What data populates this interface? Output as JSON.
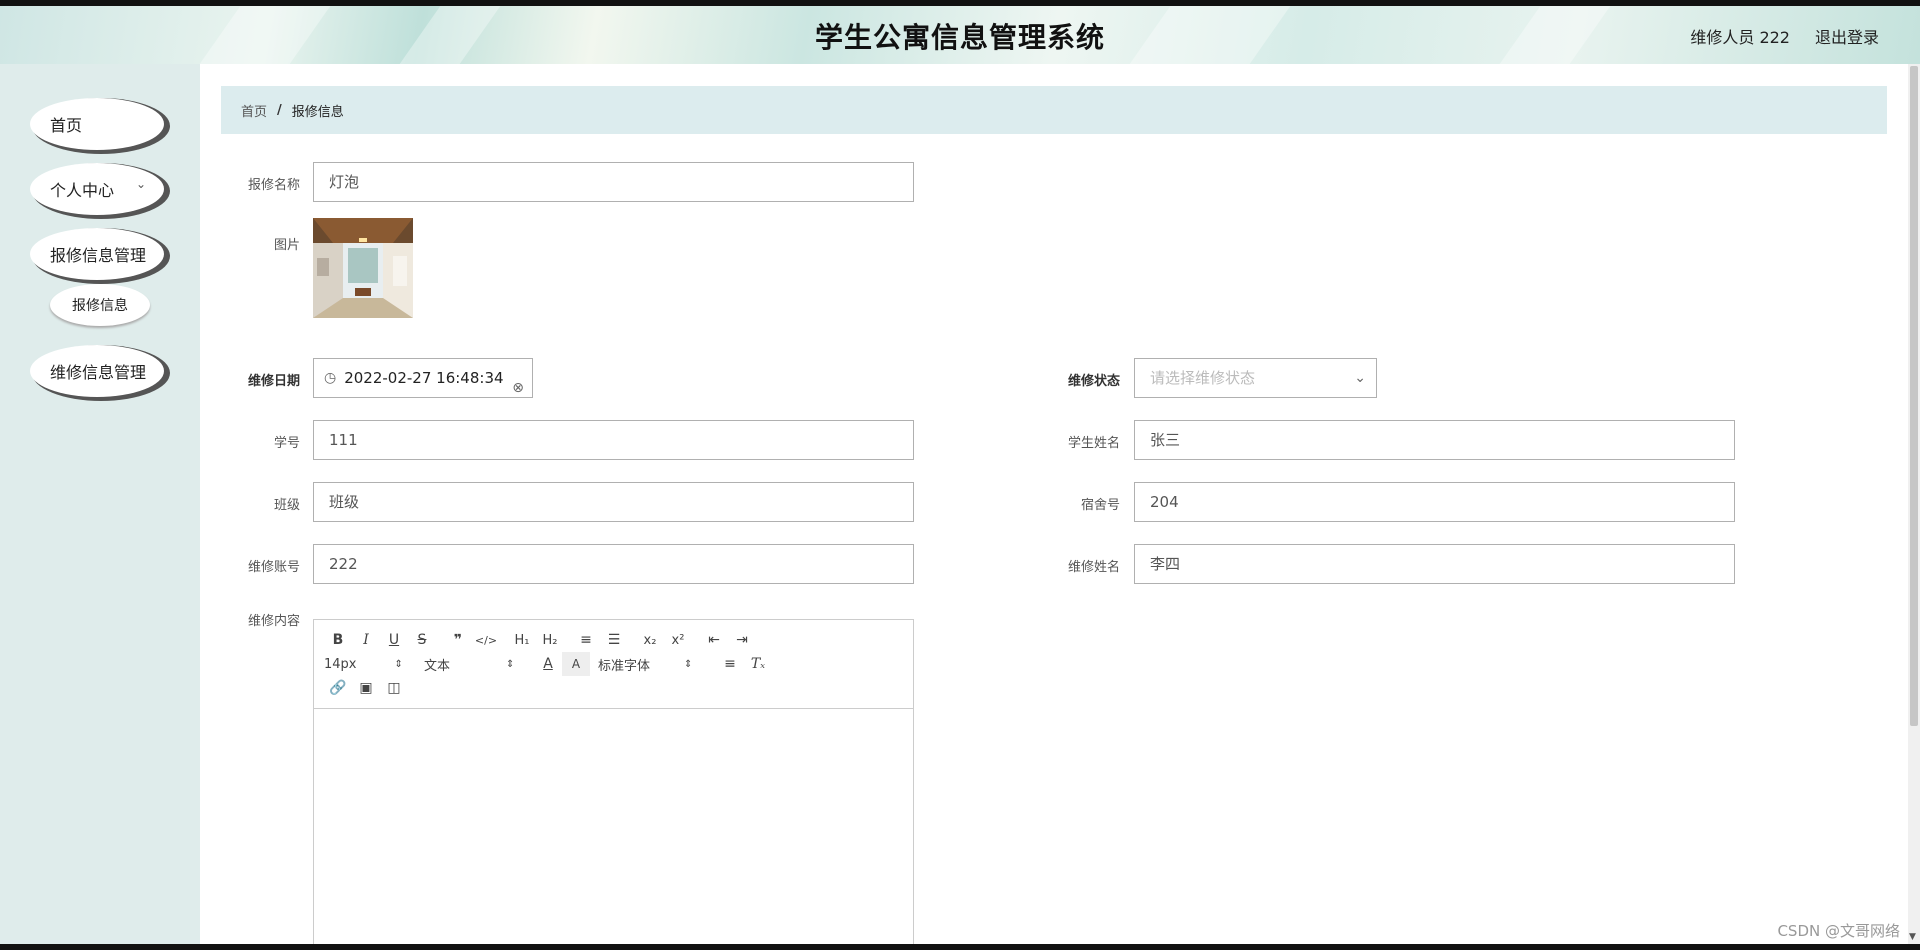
{
  "header": {
    "title": "学生公寓信息管理系统",
    "user": "维修人员 222",
    "logout": "退出登录"
  },
  "sidebar": {
    "items": [
      {
        "label": "首页"
      },
      {
        "label": "个人中心"
      },
      {
        "label": "报修信息管理"
      },
      {
        "label": "维修信息管理"
      }
    ],
    "subitems": [
      {
        "label": "报修信息"
      }
    ]
  },
  "breadcrumb": {
    "home": "首页",
    "separator": "/",
    "current": "报修信息"
  },
  "form": {
    "repair_name": {
      "label": "报修名称",
      "value": "灯泡"
    },
    "image": {
      "label": "图片"
    },
    "repair_date": {
      "label": "维修日期",
      "value": "2022-02-27 16:48:34"
    },
    "repair_status": {
      "label": "维修状态",
      "placeholder": "请选择维修状态"
    },
    "student_no": {
      "label": "学号",
      "value": "111"
    },
    "student_name": {
      "label": "学生姓名",
      "value": "张三"
    },
    "class": {
      "label": "班级",
      "value": "班级"
    },
    "dorm_no": {
      "label": "宿舍号",
      "value": "204"
    },
    "repair_account": {
      "label": "维修账号",
      "value": "222"
    },
    "repairer_name": {
      "label": "维修姓名",
      "value": "李四"
    },
    "repair_content": {
      "label": "维修内容"
    }
  },
  "editor": {
    "font_size": "14px",
    "text_type": "文本",
    "font_family": "标准字体"
  },
  "watermark": "CSDN @文哥网络"
}
